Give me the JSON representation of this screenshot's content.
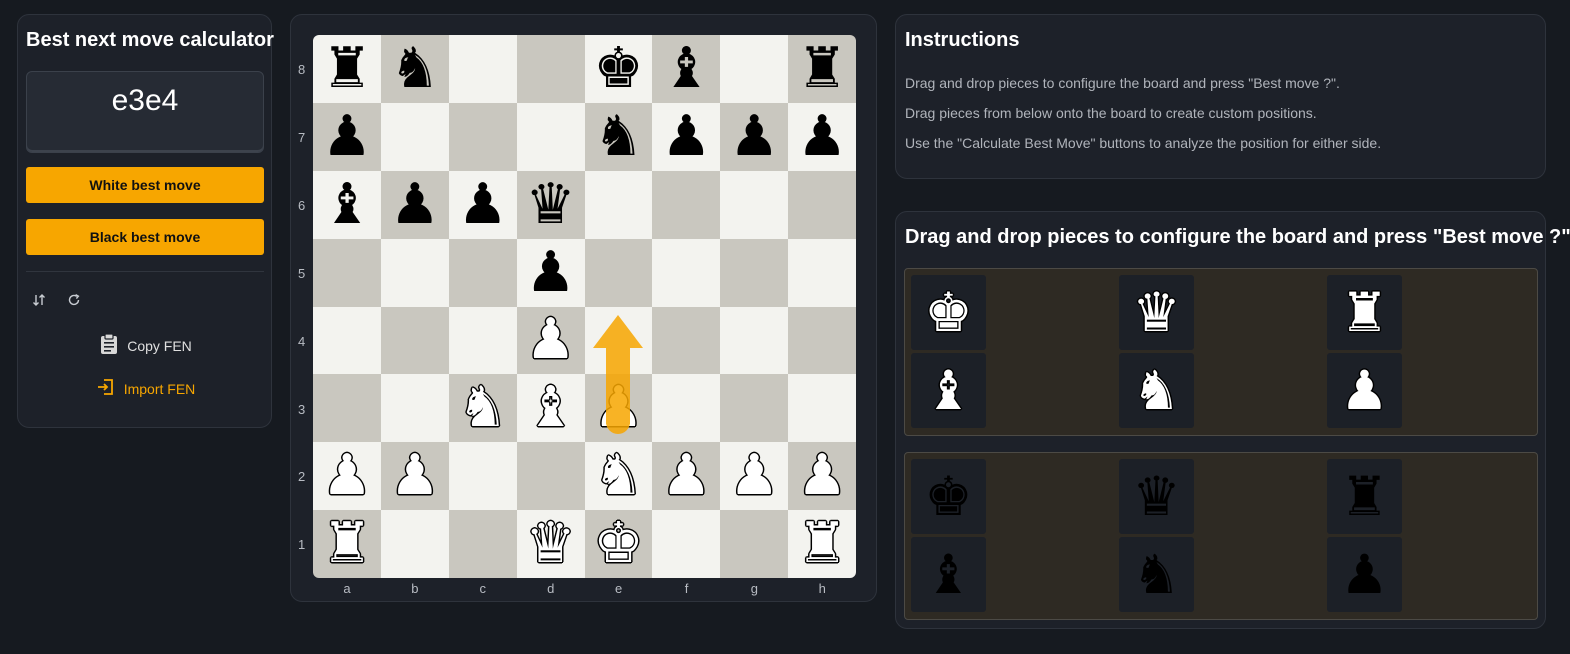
{
  "left_panel": {
    "title": "Best next move calculator",
    "best_move": "e3e4",
    "white_button": "White best move",
    "black_button": "Black best move",
    "copy_fen": "Copy FEN",
    "import_fen": "Import FEN",
    "icons": [
      "swap-vertical-icon",
      "refresh-icon",
      "clipboard-icon",
      "import-icon"
    ]
  },
  "board": {
    "ranks": [
      "8",
      "7",
      "6",
      "5",
      "4",
      "3",
      "2",
      "1"
    ],
    "files": [
      "a",
      "b",
      "c",
      "d",
      "e",
      "f",
      "g",
      "h"
    ],
    "rows": [
      [
        "r",
        "n",
        "",
        "",
        "k",
        "b",
        "",
        "r"
      ],
      [
        "p",
        "",
        "",
        "",
        "n",
        "p",
        "p",
        "p"
      ],
      [
        "b",
        "p",
        "p",
        "q",
        "",
        "",
        "",
        ""
      ],
      [
        "",
        "",
        "",
        "p",
        "",
        "",
        "",
        ""
      ],
      [
        "",
        "",
        "",
        "P",
        "",
        "",
        "",
        ""
      ],
      [
        "",
        "",
        "N",
        "B",
        "P",
        "",
        "",
        ""
      ],
      [
        "P",
        "P",
        "",
        "",
        "N",
        "P",
        "P",
        "P"
      ],
      [
        "R",
        "",
        "",
        "Q",
        "K",
        "",
        "",
        "R"
      ]
    ],
    "arrow_move": "e3e4",
    "arrow_color": "#f7a600"
  },
  "instructions": {
    "title": "Instructions",
    "lines": [
      "Drag and drop pieces to configure the board and press \"Best move ?\".",
      "Drag pieces from below onto the board to create custom positions.",
      "Use the \"Calculate Best Move\" buttons to analyze the position for either side."
    ]
  },
  "palette": {
    "title": "Drag and drop pieces to configure the board and press \"Best move ?\".",
    "white_pieces": [
      "K",
      "Q",
      "R",
      "B",
      "N",
      "P"
    ],
    "black_pieces": [
      "k",
      "q",
      "r",
      "b",
      "n",
      "p"
    ]
  },
  "colors": {
    "accent": "#f7a600",
    "background": "#161a20",
    "panel": "#1d2129",
    "light_square": "#f3f3ef",
    "dark_square": "#c9c7bf"
  }
}
